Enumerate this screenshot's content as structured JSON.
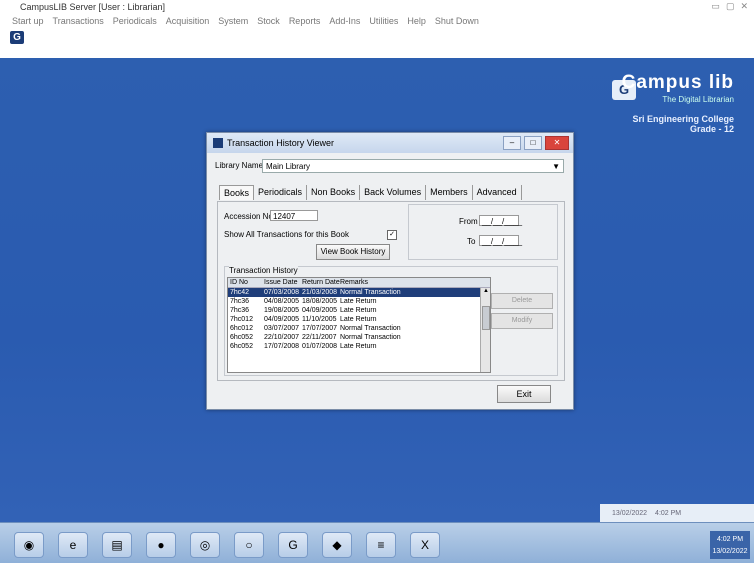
{
  "app": {
    "title": "CampusLIB Server [User : Librarian]",
    "menu": [
      "Start up",
      "Transactions",
      "Periodicals",
      "Acquisition",
      "System",
      "Stock",
      "Reports",
      "Add-Ins",
      "Utilities",
      "Help",
      "Shut Down"
    ]
  },
  "brand": {
    "name": "Campus lib",
    "tagline": "The Digital Librarian",
    "college": "Sri Engineering College",
    "grade": "Grade - 12"
  },
  "window": {
    "title": "Transaction History Viewer",
    "library_label": "Library Name",
    "library_value": "Main Library",
    "tabs": [
      "Books",
      "Periodicals",
      "Non Books",
      "Back Volumes",
      "Members",
      "Advanced"
    ],
    "accession_label": "Accession No",
    "accession_value": "12407",
    "show_all_label": "Show All Transactions for this Book",
    "show_all_checked": "✓",
    "view_history_button": "View Book History",
    "from_label": "From",
    "from_value": "__/__/____",
    "to_label": "To",
    "to_value": "__/__/____",
    "history_label": "Transaction History",
    "columns": [
      "ID No",
      "Issue Date",
      "Return Date",
      "Remarks"
    ],
    "rows": [
      [
        "7hc42",
        "07/03/2008",
        "21/03/2008",
        "Normal Transaction"
      ],
      [
        "7hc36",
        "04/08/2005",
        "18/08/2005",
        "Late Return"
      ],
      [
        "7hc36",
        "19/08/2005",
        "04/09/2005",
        "Late Return"
      ],
      [
        "7hc012",
        "04/09/2005",
        "11/10/2005",
        "Late Return"
      ],
      [
        "6hc012",
        "03/07/2007",
        "17/07/2007",
        "Normal Transaction"
      ],
      [
        "6hc052",
        "22/10/2007",
        "22/11/2007",
        "Normal Transaction"
      ],
      [
        "6hc052",
        "17/07/2008",
        "01/07/2008",
        "Late Return"
      ]
    ],
    "side_buttons": [
      "Delete",
      "Modify"
    ],
    "exit_button": "Exit"
  },
  "sysbar": {
    "date": "13/02/2022",
    "time": "4:02 PM"
  },
  "taskbar": {
    "icons": [
      "windows-start",
      "internet-explorer",
      "folder",
      "firefox",
      "chrome",
      "media-player",
      "campuslib",
      "app",
      "notepad",
      "excel"
    ],
    "clock_time": "4:02 PM",
    "clock_date": "13/02/2022"
  }
}
